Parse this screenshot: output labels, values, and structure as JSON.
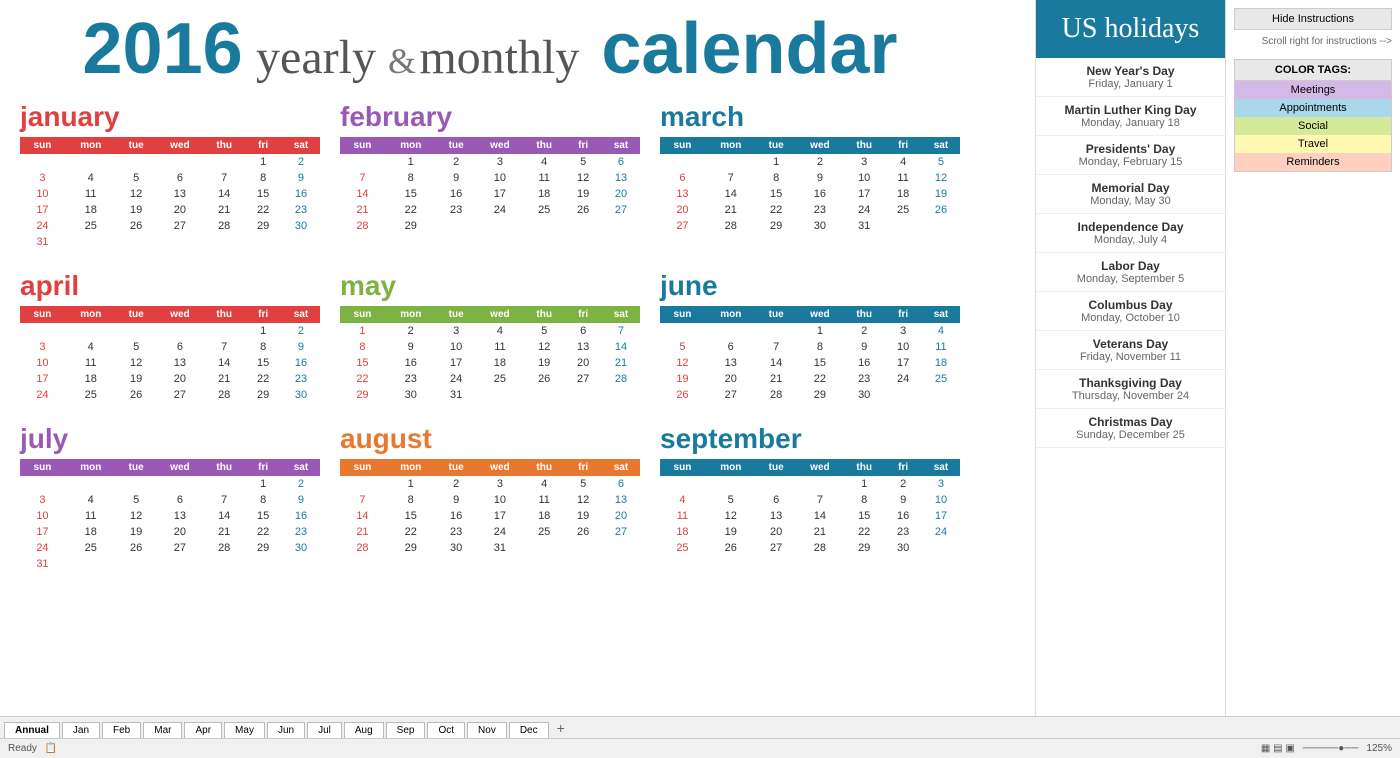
{
  "app": {
    "status": "Ready",
    "zoom": "125%"
  },
  "header": {
    "hide_instructions_btn": "Hide Instructions",
    "scroll_note": "Scroll right for instructions -->",
    "color_tags_title": "COLOR TAGS:",
    "color_tags": [
      {
        "label": "Meetings",
        "class": "meetings"
      },
      {
        "label": "Appointments",
        "class": "appointments"
      },
      {
        "label": "Social",
        "class": "social"
      },
      {
        "label": "Travel",
        "class": "travel"
      },
      {
        "label": "Reminders",
        "class": "reminders"
      }
    ]
  },
  "calendar": {
    "title_year": "2016",
    "title_yearly": "yearly",
    "title_ampersand": "&",
    "title_monthly": "monthly",
    "title_calendar": "calendar"
  },
  "holidays_title": "US holidays",
  "holidays": [
    {
      "name": "New Year's Day",
      "date": "Friday, January 1"
    },
    {
      "name": "Martin Luther King Day",
      "date": "Monday, January 18"
    },
    {
      "name": "Presidents' Day",
      "date": "Monday, February 15"
    },
    {
      "name": "Memorial Day",
      "date": "Monday, May 30"
    },
    {
      "name": "Independence Day",
      "date": "Monday, July 4"
    },
    {
      "name": "Labor Day",
      "date": "Monday, September 5"
    },
    {
      "name": "Columbus Day",
      "date": "Monday, October 10"
    },
    {
      "name": "Veterans Day",
      "date": "Friday, November 11"
    },
    {
      "name": "Thanksgiving Day",
      "date": "Thursday, November 24"
    },
    {
      "name": "Christmas Day",
      "date": "Sunday, December 25"
    }
  ],
  "months": [
    {
      "name": "january",
      "class": "jan",
      "hdr_class": "hdr-red",
      "days": [
        "sun",
        "mon",
        "tue",
        "wed",
        "thu",
        "fri",
        "sat"
      ],
      "weeks": [
        [
          "",
          "",
          "",
          "",
          "",
          "1",
          "2"
        ],
        [
          "3",
          "4",
          "5",
          "6",
          "7",
          "8",
          "9"
        ],
        [
          "10",
          "11",
          "12",
          "13",
          "14",
          "15",
          "16"
        ],
        [
          "17",
          "18",
          "19",
          "20",
          "21",
          "22",
          "23"
        ],
        [
          "24",
          "25",
          "26",
          "27",
          "28",
          "29",
          "30"
        ],
        [
          "31",
          "",
          "",
          "",
          "",
          "",
          ""
        ]
      ]
    },
    {
      "name": "february",
      "class": "feb",
      "hdr_class": "hdr-purple",
      "days": [
        "sun",
        "mon",
        "tue",
        "wed",
        "thu",
        "fri",
        "sat"
      ],
      "weeks": [
        [
          "",
          "1",
          "2",
          "3",
          "4",
          "5",
          "6"
        ],
        [
          "7",
          "8",
          "9",
          "10",
          "11",
          "12",
          "13"
        ],
        [
          "14",
          "15",
          "16",
          "17",
          "18",
          "19",
          "20"
        ],
        [
          "21",
          "22",
          "23",
          "24",
          "25",
          "26",
          "27"
        ],
        [
          "28",
          "29",
          "",
          "",
          "",
          "",
          ""
        ]
      ]
    },
    {
      "name": "march",
      "class": "mar",
      "hdr_class": "hdr-blue",
      "days": [
        "sun",
        "mon",
        "tue",
        "wed",
        "thu",
        "fri",
        "sat"
      ],
      "weeks": [
        [
          "",
          "",
          "1",
          "2",
          "3",
          "4",
          "5"
        ],
        [
          "6",
          "7",
          "8",
          "9",
          "10",
          "11",
          "12"
        ],
        [
          "13",
          "14",
          "15",
          "16",
          "17",
          "18",
          "19"
        ],
        [
          "20",
          "21",
          "22",
          "23",
          "24",
          "25",
          "26"
        ],
        [
          "27",
          "28",
          "29",
          "30",
          "31",
          "",
          ""
        ]
      ]
    },
    {
      "name": "april",
      "class": "apr",
      "hdr_class": "hdr-red",
      "days": [
        "sun",
        "mon",
        "tue",
        "wed",
        "thu",
        "fri",
        "sat"
      ],
      "weeks": [
        [
          "",
          "",
          "",
          "",
          "",
          "1",
          "2"
        ],
        [
          "3",
          "4",
          "5",
          "6",
          "7",
          "8",
          "9"
        ],
        [
          "10",
          "11",
          "12",
          "13",
          "14",
          "15",
          "16"
        ],
        [
          "17",
          "18",
          "19",
          "20",
          "21",
          "22",
          "23"
        ],
        [
          "24",
          "25",
          "26",
          "27",
          "28",
          "29",
          "30"
        ]
      ]
    },
    {
      "name": "may",
      "class": "may",
      "hdr_class": "hdr-green",
      "days": [
        "sun",
        "mon",
        "tue",
        "wed",
        "thu",
        "fri",
        "sat"
      ],
      "weeks": [
        [
          "1",
          "2",
          "3",
          "4",
          "5",
          "6",
          "7"
        ],
        [
          "8",
          "9",
          "10",
          "11",
          "12",
          "13",
          "14"
        ],
        [
          "15",
          "16",
          "17",
          "18",
          "19",
          "20",
          "21"
        ],
        [
          "22",
          "23",
          "24",
          "25",
          "26",
          "27",
          "28"
        ],
        [
          "29",
          "30",
          "31",
          "",
          "",
          "",
          ""
        ]
      ]
    },
    {
      "name": "june",
      "class": "jun",
      "hdr_class": "hdr-blue",
      "days": [
        "sun",
        "mon",
        "tue",
        "wed",
        "thu",
        "fri",
        "sat"
      ],
      "weeks": [
        [
          "",
          "",
          "",
          "1",
          "2",
          "3",
          "4"
        ],
        [
          "5",
          "6",
          "7",
          "8",
          "9",
          "10",
          "11"
        ],
        [
          "12",
          "13",
          "14",
          "15",
          "16",
          "17",
          "18"
        ],
        [
          "19",
          "20",
          "21",
          "22",
          "23",
          "24",
          "25"
        ],
        [
          "26",
          "27",
          "28",
          "29",
          "30",
          "",
          ""
        ]
      ]
    },
    {
      "name": "july",
      "class": "jul",
      "hdr_class": "hdr-purple",
      "days": [
        "sun",
        "mon",
        "tue",
        "wed",
        "thu",
        "fri",
        "sat"
      ],
      "weeks": [
        [
          "",
          "",
          "",
          "",
          "",
          "1",
          "2"
        ],
        [
          "3",
          "4",
          "5",
          "6",
          "7",
          "8",
          "9"
        ],
        [
          "10",
          "11",
          "12",
          "13",
          "14",
          "15",
          "16"
        ],
        [
          "17",
          "18",
          "19",
          "20",
          "21",
          "22",
          "23"
        ],
        [
          "24",
          "25",
          "26",
          "27",
          "28",
          "29",
          "30"
        ],
        [
          "31",
          "",
          "",
          "",
          "",
          "",
          ""
        ]
      ]
    },
    {
      "name": "august",
      "class": "aug",
      "hdr_class": "hdr-orange",
      "days": [
        "sun",
        "mon",
        "tue",
        "wed",
        "thu",
        "fri",
        "sat"
      ],
      "weeks": [
        [
          "",
          "1",
          "2",
          "3",
          "4",
          "5",
          "6"
        ],
        [
          "7",
          "8",
          "9",
          "10",
          "11",
          "12",
          "13"
        ],
        [
          "14",
          "15",
          "16",
          "17",
          "18",
          "19",
          "20"
        ],
        [
          "21",
          "22",
          "23",
          "24",
          "25",
          "26",
          "27"
        ],
        [
          "28",
          "29",
          "30",
          "31",
          "",
          "",
          ""
        ]
      ]
    },
    {
      "name": "september",
      "class": "sep",
      "hdr_class": "hdr-teal",
      "days": [
        "sun",
        "mon",
        "tue",
        "wed",
        "thu",
        "fri",
        "sat"
      ],
      "weeks": [
        [
          "",
          "",
          "",
          "",
          "1",
          "2",
          "3"
        ],
        [
          "4",
          "5",
          "6",
          "7",
          "8",
          "9",
          "10"
        ],
        [
          "11",
          "12",
          "13",
          "14",
          "15",
          "16",
          "17"
        ],
        [
          "18",
          "19",
          "20",
          "21",
          "22",
          "23",
          "24"
        ],
        [
          "25",
          "26",
          "27",
          "28",
          "29",
          "30",
          ""
        ]
      ]
    }
  ],
  "sheet_tabs": [
    "Annual",
    "Jan",
    "Feb",
    "Mar",
    "Apr",
    "May",
    "Jun",
    "Jul",
    "Aug",
    "Sep",
    "Oct",
    "Nov",
    "Dec"
  ]
}
